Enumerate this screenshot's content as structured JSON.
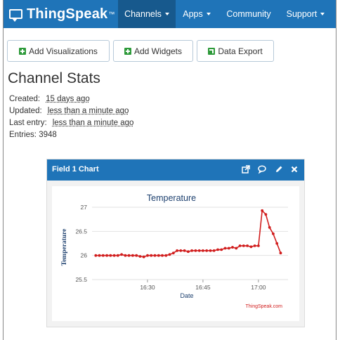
{
  "navbar": {
    "brand": "ThingSpeak",
    "tm": "™",
    "items": [
      {
        "label": "Channels",
        "dropdown": true,
        "active": true
      },
      {
        "label": "Apps",
        "dropdown": true,
        "active": false
      },
      {
        "label": "Community",
        "dropdown": false,
        "active": false
      },
      {
        "label": "Support",
        "dropdown": true,
        "active": false
      }
    ]
  },
  "toolbar": {
    "add_visualizations": "Add Visualizations",
    "add_widgets": "Add Widgets",
    "data_export": "Data Export"
  },
  "stats": {
    "title": "Channel Stats",
    "created_label": "Created:",
    "created_value": "15 days ago",
    "updated_label": "Updated:",
    "updated_value": "less than a minute ago",
    "last_entry_label": "Last entry:",
    "last_entry_value": "less than a minute ago",
    "entries_label": "Entries:",
    "entries_value": "3948"
  },
  "card": {
    "title": "Field 1 Chart",
    "icons": [
      "external-link-icon",
      "comment-icon",
      "pencil-icon",
      "close-icon"
    ]
  },
  "chart_data": {
    "type": "line",
    "title": "Temperature",
    "xlabel": "Date",
    "ylabel": "Temperature",
    "credit": "ThingSpeak.com",
    "ylim": [
      25.5,
      27
    ],
    "xlim_minutes": [
      15,
      68
    ],
    "yticks": [
      "27",
      "26.5",
      "26",
      "25.5"
    ],
    "ytick_values": [
      27,
      26.5,
      26,
      25.5
    ],
    "xticks": [
      "16:30",
      "16:45",
      "17:00"
    ],
    "xtick_minutes": [
      30,
      45,
      60
    ],
    "grid": true,
    "color": "#d11d1d",
    "series": [
      {
        "x": [
          16,
          17,
          18,
          19,
          20,
          21,
          22,
          23,
          24,
          25,
          26,
          27,
          28,
          29,
          30,
          31,
          32,
          33,
          34,
          35,
          36,
          37,
          38,
          39,
          40,
          41,
          42,
          43,
          44,
          45,
          46,
          47,
          48,
          49,
          50,
          51,
          52,
          53,
          54,
          55,
          56,
          57,
          58,
          59,
          60,
          61,
          62,
          63,
          64,
          65,
          66
        ],
        "y": [
          26.0,
          26.0,
          26.0,
          26.0,
          26.0,
          26.0,
          26.0,
          26.02,
          26.0,
          26.0,
          26.0,
          26.0,
          25.98,
          25.97,
          26.0,
          26.0,
          26.0,
          26.0,
          26.0,
          26.0,
          26.02,
          26.05,
          26.1,
          26.1,
          26.1,
          26.08,
          26.1,
          26.1,
          26.1,
          26.1,
          26.1,
          26.1,
          26.1,
          26.12,
          26.12,
          26.15,
          26.15,
          26.17,
          26.15,
          26.2,
          26.2,
          26.2,
          26.18,
          26.2,
          26.2,
          26.93,
          26.85,
          26.58,
          26.45,
          26.25,
          26.05
        ]
      }
    ]
  }
}
